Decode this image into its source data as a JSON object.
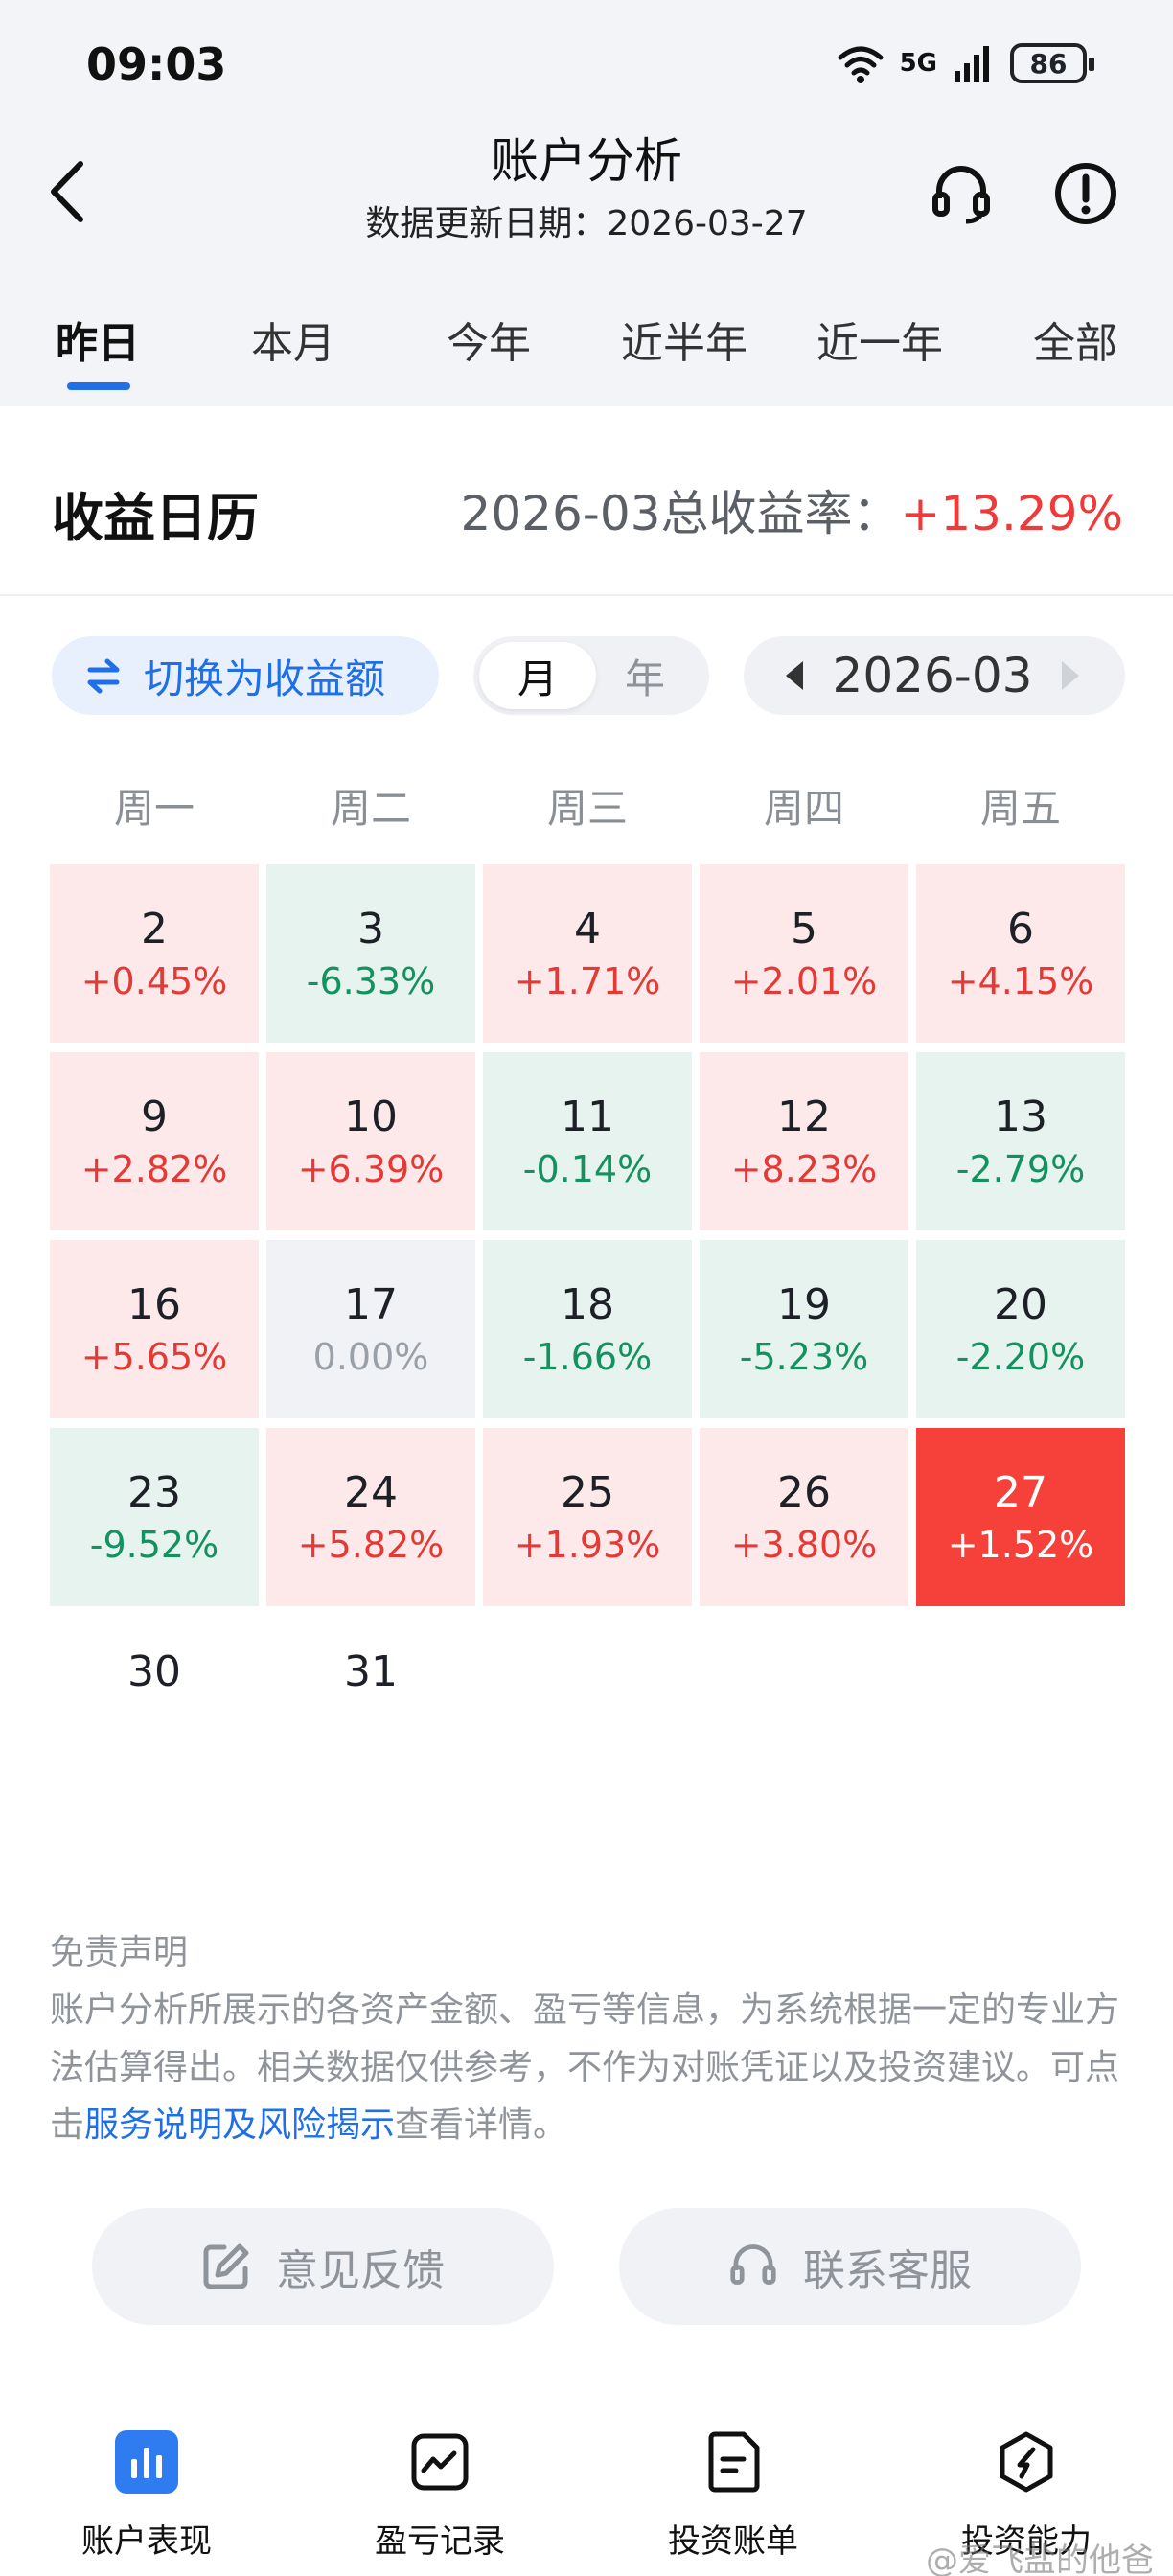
{
  "status_bar": {
    "time": "09:03",
    "network": "5G",
    "battery": "86"
  },
  "header": {
    "title": "账户分析",
    "update_date": "数据更新日期：2026-03-27"
  },
  "tabs": [
    "昨日",
    "本月",
    "今年",
    "近半年",
    "近一年",
    "全部"
  ],
  "active_tab": "昨日",
  "calendar_section": {
    "title": "收益日历",
    "rate_label": "2026-03总收益率：",
    "rate_value": "+13.29%",
    "switch_label": "切换为收益额",
    "segment": [
      "月",
      "年"
    ],
    "active_segment": "月",
    "month": "2026-03",
    "weekdays": [
      "周一",
      "周二",
      "周三",
      "周四",
      "周五"
    ],
    "days": [
      {
        "day": "2",
        "pct": "+0.45%",
        "state": "pos"
      },
      {
        "day": "3",
        "pct": "-6.33%",
        "state": "neg"
      },
      {
        "day": "4",
        "pct": "+1.71%",
        "state": "pos"
      },
      {
        "day": "5",
        "pct": "+2.01%",
        "state": "pos"
      },
      {
        "day": "6",
        "pct": "+4.15%",
        "state": "pos"
      },
      {
        "day": "9",
        "pct": "+2.82%",
        "state": "pos"
      },
      {
        "day": "10",
        "pct": "+6.39%",
        "state": "pos"
      },
      {
        "day": "11",
        "pct": "-0.14%",
        "state": "neg"
      },
      {
        "day": "12",
        "pct": "+8.23%",
        "state": "pos"
      },
      {
        "day": "13",
        "pct": "-2.79%",
        "state": "neg"
      },
      {
        "day": "16",
        "pct": "+5.65%",
        "state": "pos"
      },
      {
        "day": "17",
        "pct": "0.00%",
        "state": "zero"
      },
      {
        "day": "18",
        "pct": "-1.66%",
        "state": "neg"
      },
      {
        "day": "19",
        "pct": "-5.23%",
        "state": "neg"
      },
      {
        "day": "20",
        "pct": "-2.20%",
        "state": "neg"
      },
      {
        "day": "23",
        "pct": "-9.52%",
        "state": "neg"
      },
      {
        "day": "24",
        "pct": "+5.82%",
        "state": "pos"
      },
      {
        "day": "25",
        "pct": "+1.93%",
        "state": "pos"
      },
      {
        "day": "26",
        "pct": "+3.80%",
        "state": "pos"
      },
      {
        "day": "27",
        "pct": "+1.52%",
        "state": "current"
      },
      {
        "day": "30",
        "pct": "",
        "state": "plain"
      },
      {
        "day": "31",
        "pct": "",
        "state": "plain"
      }
    ]
  },
  "disclaimer": {
    "title": "免责声明",
    "text_before": "账户分析所展示的各资产金额、盈亏等信息，为系统根据一定的专业方法估算得出。相关数据仅供参考，不作为对账凭证以及投资建议。可点击",
    "link": "服务说明及风险揭示",
    "text_after": "查看详情。"
  },
  "actions": {
    "feedback": "意见反馈",
    "service": "联系客服"
  },
  "bottom_nav": [
    {
      "label": "账户表现",
      "icon": "bar-chart-icon"
    },
    {
      "label": "盈亏记录",
      "icon": "trend-chart-icon"
    },
    {
      "label": "投资账单",
      "icon": "bill-document-icon"
    },
    {
      "label": "投资能力",
      "icon": "compass-hexagon-icon"
    }
  ],
  "watermark": "@爱飞盐的他爸",
  "colors": {
    "accent": "#1e6fe8",
    "up": "#e53935",
    "down": "#13915f",
    "up_bg": "#fde9ea",
    "down_bg": "#e6f3ef",
    "current_bg": "#f6403a"
  }
}
